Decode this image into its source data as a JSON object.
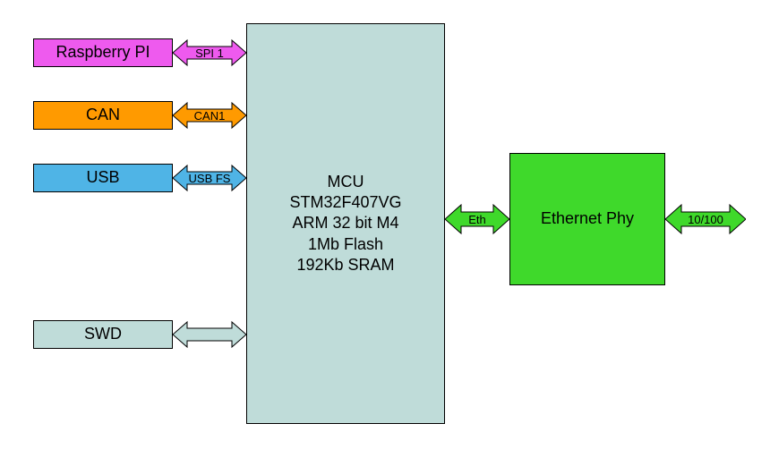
{
  "blocks": {
    "raspberry": "Raspberry PI",
    "can": "CAN",
    "usb": "USB",
    "swd": "SWD",
    "mcu": "MCU\nSTM32F407VG\nARM 32 bit M4\n1Mb Flash\n192Kb SRAM",
    "eth_phy": "Ethernet Phy"
  },
  "links": {
    "spi1": "SPI 1",
    "can1": "CAN1",
    "usb_fs": "USB FS",
    "swd_link": "",
    "eth": "Eth",
    "ten_hundred": "10/100"
  },
  "colors": {
    "magenta": "#ee5aee",
    "orange": "#ff9a00",
    "blue": "#4fb4e6",
    "lightcyan": "#bfdcd9",
    "green": "#3fd92b"
  }
}
